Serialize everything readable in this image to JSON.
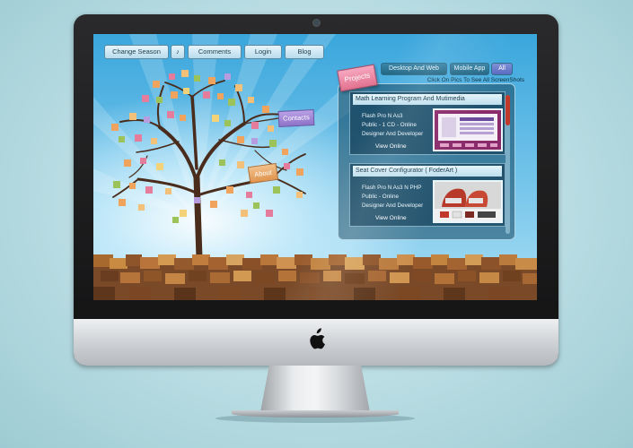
{
  "nav": {
    "change_season": "Change Season",
    "music_toggle": "♪",
    "comments": "Comments",
    "login": "Login",
    "blog": "Blog"
  },
  "signs": {
    "contacts": "Contacts",
    "about": "About",
    "projects": "Projects"
  },
  "filters": {
    "desktop_web": "Desktop And Web",
    "mobile_app": "Mobile App",
    "all": "All",
    "active": "All"
  },
  "projects": {
    "hint": "Click On Pics To See All ScreenShots",
    "items": [
      {
        "title": "Math Learning Program And Mutimedia",
        "tech": "Flash Pro N As3",
        "access": "Public - 1 CD - Online",
        "role": "Designer And Developer",
        "link": "View Online"
      },
      {
        "title": "Seat Cover Configurator ( FoderArt )",
        "tech": "Flash Pro N As3 N PHP",
        "access": "Public - Online",
        "role": "Designer And Developer",
        "link": "View Online"
      }
    ]
  },
  "colors": {
    "sky_top": "#3aa6dc",
    "trunk": "#4a2c1c",
    "panel_bg": "#14465f",
    "accent_red": "#c0392b",
    "projects_sign": "#e2728f",
    "contacts_sign": "#8e72c8",
    "about_sign": "#e09550"
  },
  "icons": {
    "logo": "apple-logo",
    "music": "music-note-icon"
  }
}
